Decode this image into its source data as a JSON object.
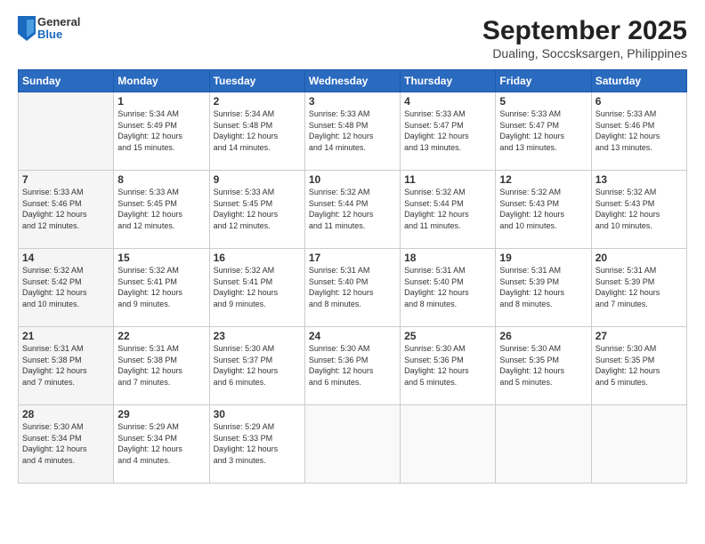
{
  "header": {
    "logo": {
      "general": "General",
      "blue": "Blue"
    },
    "title": "September 2025",
    "subtitle": "Dualing, Soccsksargen, Philippines"
  },
  "days": [
    "Sunday",
    "Monday",
    "Tuesday",
    "Wednesday",
    "Thursday",
    "Friday",
    "Saturday"
  ],
  "weeks": [
    [
      {
        "num": "",
        "info": ""
      },
      {
        "num": "1",
        "info": "Sunrise: 5:34 AM\nSunset: 5:49 PM\nDaylight: 12 hours\nand 15 minutes."
      },
      {
        "num": "2",
        "info": "Sunrise: 5:34 AM\nSunset: 5:48 PM\nDaylight: 12 hours\nand 14 minutes."
      },
      {
        "num": "3",
        "info": "Sunrise: 5:33 AM\nSunset: 5:48 PM\nDaylight: 12 hours\nand 14 minutes."
      },
      {
        "num": "4",
        "info": "Sunrise: 5:33 AM\nSunset: 5:47 PM\nDaylight: 12 hours\nand 13 minutes."
      },
      {
        "num": "5",
        "info": "Sunrise: 5:33 AM\nSunset: 5:47 PM\nDaylight: 12 hours\nand 13 minutes."
      },
      {
        "num": "6",
        "info": "Sunrise: 5:33 AM\nSunset: 5:46 PM\nDaylight: 12 hours\nand 13 minutes."
      }
    ],
    [
      {
        "num": "7",
        "info": "Sunrise: 5:33 AM\nSunset: 5:46 PM\nDaylight: 12 hours\nand 12 minutes."
      },
      {
        "num": "8",
        "info": "Sunrise: 5:33 AM\nSunset: 5:45 PM\nDaylight: 12 hours\nand 12 minutes."
      },
      {
        "num": "9",
        "info": "Sunrise: 5:33 AM\nSunset: 5:45 PM\nDaylight: 12 hours\nand 12 minutes."
      },
      {
        "num": "10",
        "info": "Sunrise: 5:32 AM\nSunset: 5:44 PM\nDaylight: 12 hours\nand 11 minutes."
      },
      {
        "num": "11",
        "info": "Sunrise: 5:32 AM\nSunset: 5:44 PM\nDaylight: 12 hours\nand 11 minutes."
      },
      {
        "num": "12",
        "info": "Sunrise: 5:32 AM\nSunset: 5:43 PM\nDaylight: 12 hours\nand 10 minutes."
      },
      {
        "num": "13",
        "info": "Sunrise: 5:32 AM\nSunset: 5:43 PM\nDaylight: 12 hours\nand 10 minutes."
      }
    ],
    [
      {
        "num": "14",
        "info": "Sunrise: 5:32 AM\nSunset: 5:42 PM\nDaylight: 12 hours\nand 10 minutes."
      },
      {
        "num": "15",
        "info": "Sunrise: 5:32 AM\nSunset: 5:41 PM\nDaylight: 12 hours\nand 9 minutes."
      },
      {
        "num": "16",
        "info": "Sunrise: 5:32 AM\nSunset: 5:41 PM\nDaylight: 12 hours\nand 9 minutes."
      },
      {
        "num": "17",
        "info": "Sunrise: 5:31 AM\nSunset: 5:40 PM\nDaylight: 12 hours\nand 8 minutes."
      },
      {
        "num": "18",
        "info": "Sunrise: 5:31 AM\nSunset: 5:40 PM\nDaylight: 12 hours\nand 8 minutes."
      },
      {
        "num": "19",
        "info": "Sunrise: 5:31 AM\nSunset: 5:39 PM\nDaylight: 12 hours\nand 8 minutes."
      },
      {
        "num": "20",
        "info": "Sunrise: 5:31 AM\nSunset: 5:39 PM\nDaylight: 12 hours\nand 7 minutes."
      }
    ],
    [
      {
        "num": "21",
        "info": "Sunrise: 5:31 AM\nSunset: 5:38 PM\nDaylight: 12 hours\nand 7 minutes."
      },
      {
        "num": "22",
        "info": "Sunrise: 5:31 AM\nSunset: 5:38 PM\nDaylight: 12 hours\nand 7 minutes."
      },
      {
        "num": "23",
        "info": "Sunrise: 5:30 AM\nSunset: 5:37 PM\nDaylight: 12 hours\nand 6 minutes."
      },
      {
        "num": "24",
        "info": "Sunrise: 5:30 AM\nSunset: 5:36 PM\nDaylight: 12 hours\nand 6 minutes."
      },
      {
        "num": "25",
        "info": "Sunrise: 5:30 AM\nSunset: 5:36 PM\nDaylight: 12 hours\nand 5 minutes."
      },
      {
        "num": "26",
        "info": "Sunrise: 5:30 AM\nSunset: 5:35 PM\nDaylight: 12 hours\nand 5 minutes."
      },
      {
        "num": "27",
        "info": "Sunrise: 5:30 AM\nSunset: 5:35 PM\nDaylight: 12 hours\nand 5 minutes."
      }
    ],
    [
      {
        "num": "28",
        "info": "Sunrise: 5:30 AM\nSunset: 5:34 PM\nDaylight: 12 hours\nand 4 minutes."
      },
      {
        "num": "29",
        "info": "Sunrise: 5:29 AM\nSunset: 5:34 PM\nDaylight: 12 hours\nand 4 minutes."
      },
      {
        "num": "30",
        "info": "Sunrise: 5:29 AM\nSunset: 5:33 PM\nDaylight: 12 hours\nand 3 minutes."
      },
      {
        "num": "",
        "info": ""
      },
      {
        "num": "",
        "info": ""
      },
      {
        "num": "",
        "info": ""
      },
      {
        "num": "",
        "info": ""
      }
    ]
  ]
}
